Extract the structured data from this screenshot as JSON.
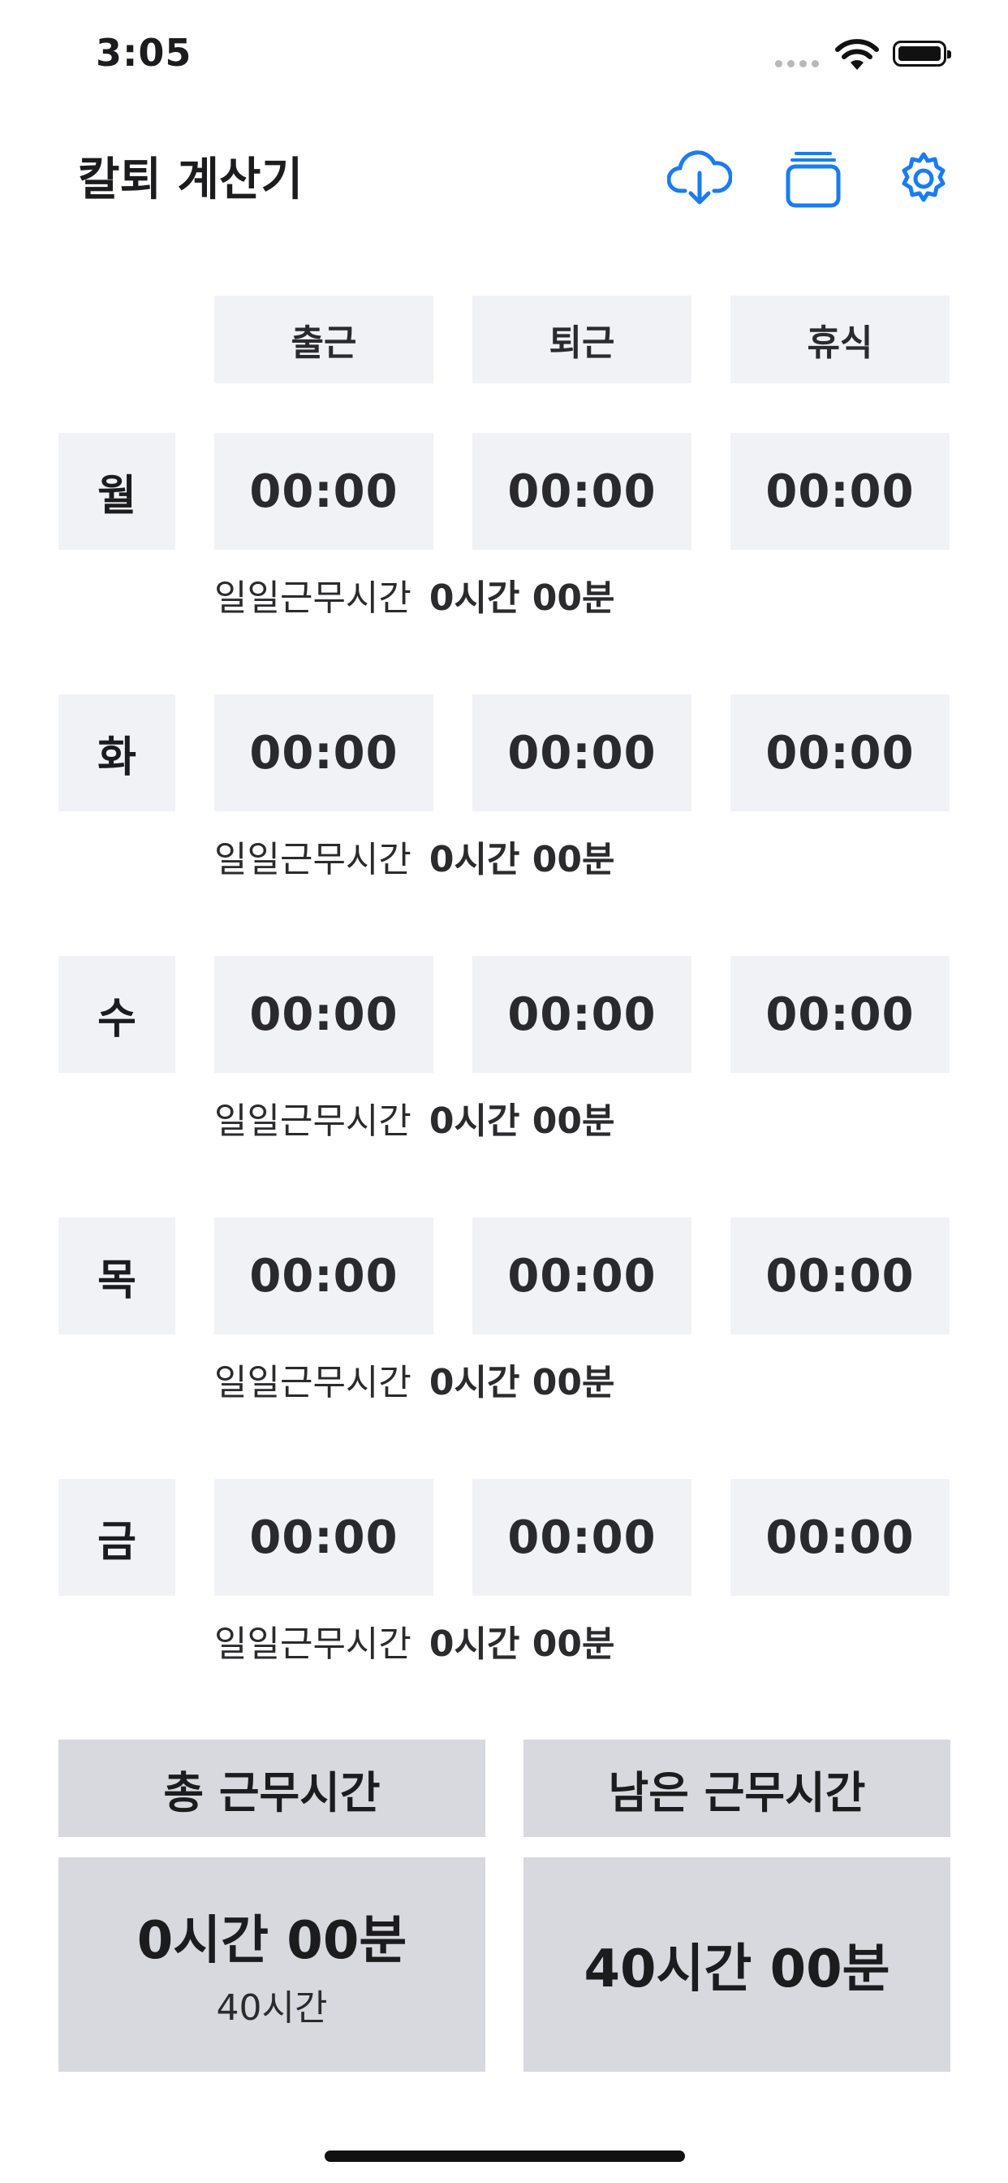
{
  "status": {
    "time": "3:05"
  },
  "app": {
    "title": "칼퇴 계산기"
  },
  "icons": {
    "download": "cloud-download-icon",
    "cards": "stacked-cards-icon",
    "settings": "gear-icon",
    "accent": "#1a7cf2"
  },
  "headers": [
    "출근",
    "퇴근",
    "휴식"
  ],
  "daily_label": "일일근무시간",
  "days": [
    {
      "day": "월",
      "start": "00:00",
      "end": "00:00",
      "break": "00:00",
      "daily": "0시간 00분"
    },
    {
      "day": "화",
      "start": "00:00",
      "end": "00:00",
      "break": "00:00",
      "daily": "0시간 00분"
    },
    {
      "day": "수",
      "start": "00:00",
      "end": "00:00",
      "break": "00:00",
      "daily": "0시간 00분"
    },
    {
      "day": "목",
      "start": "00:00",
      "end": "00:00",
      "break": "00:00",
      "daily": "0시간 00분"
    },
    {
      "day": "금",
      "start": "00:00",
      "end": "00:00",
      "break": "00:00",
      "daily": "0시간 00분"
    }
  ],
  "summary": {
    "total_label": "총 근무시간",
    "total_value": "0시간 00분",
    "total_target": "40시간",
    "remaining_label": "남은 근무시간",
    "remaining_value": "40시간 00분"
  }
}
